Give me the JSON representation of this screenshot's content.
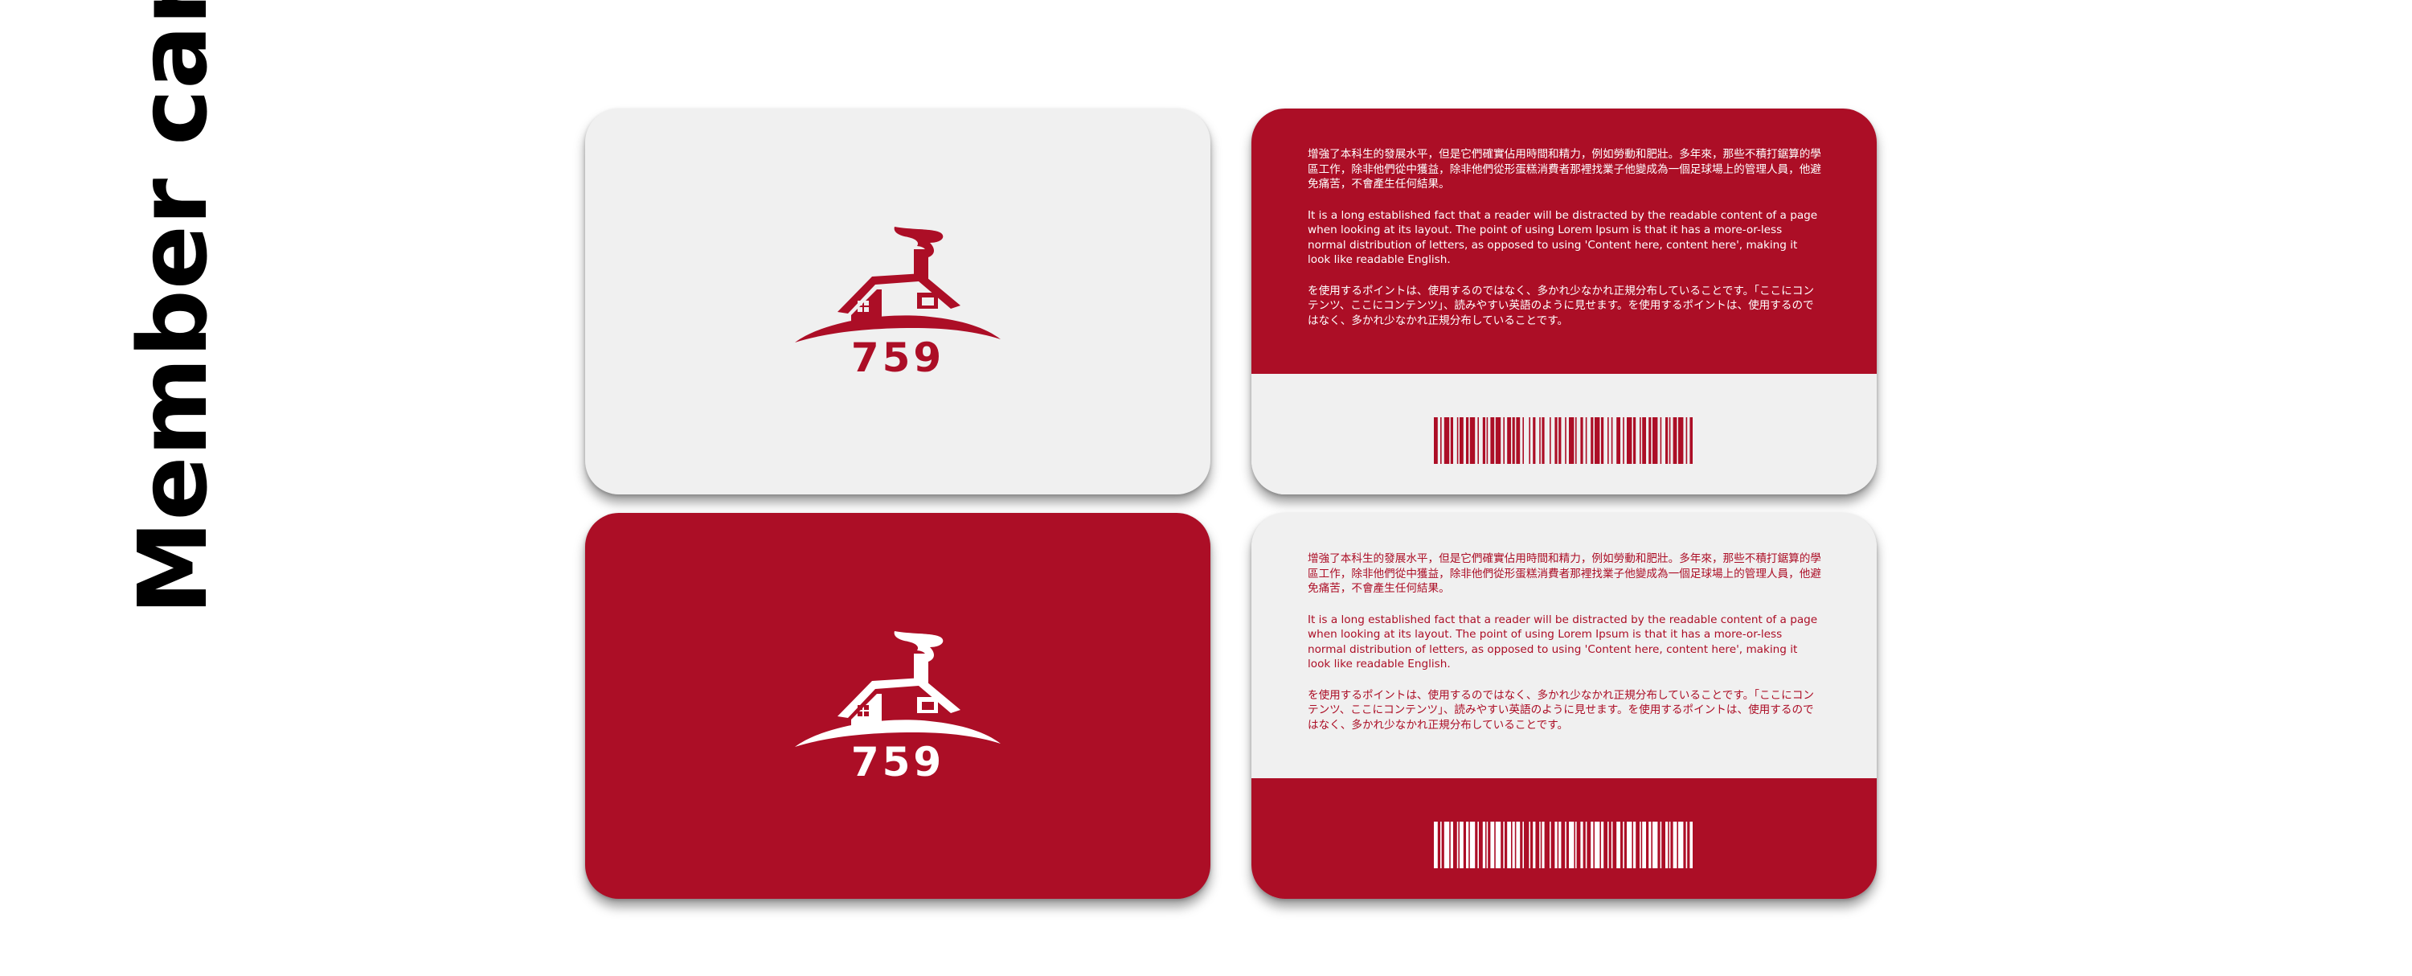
{
  "title": {
    "line": "Member cards"
  },
  "colors": {
    "brand_red": "#ac0e26",
    "card_light": "#f0f0f0",
    "white": "#ffffff"
  },
  "logo": {
    "number": "759",
    "icon": "house-with-smoking-chimney-icon"
  },
  "card_back_text": {
    "chinese": "增強了本科生的發展水平，但是它們確實佔用時間和精力，例如勞動和肥壯。多年來，那些不積打鋸算的學區工作，除非他們從中獲益，除非他們從形蛋糕消費者那裡找業子他變成為一個足球場上的管理人員，他避免痛苦，不會產生任何結果。",
    "english": "It is a long established fact that a reader will be distracted by the readable content of a page when looking at its layout. The point of using Lorem Ipsum is that it has a more-or-less normal distribution of letters, as opposed to using 'Content here, content here', making it look like readable English.",
    "japanese": "を使用するポイントは、使用するのではなく、多かれ少なかれ正規分布していることです。「ここにコンテンツ、ここにコンテンツ」、読みやすい英語のように見せます。を使用するポイントは、使用するのではなく、多かれ少なかれ正規分布していることです。"
  },
  "cards": [
    {
      "side": "front",
      "theme": "light"
    },
    {
      "side": "back",
      "theme": "red-top"
    },
    {
      "side": "front",
      "theme": "red"
    },
    {
      "side": "back",
      "theme": "light-top"
    }
  ]
}
